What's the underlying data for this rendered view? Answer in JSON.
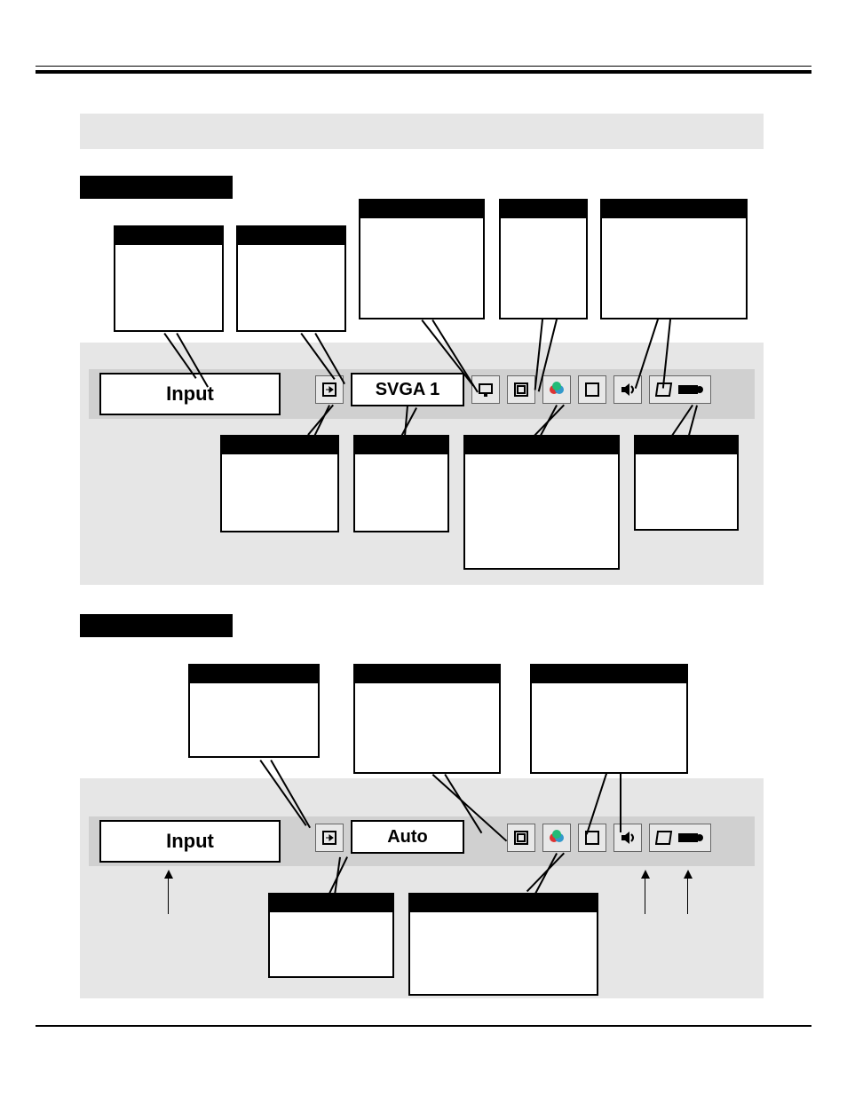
{
  "computer_mode": {
    "menubar": {
      "input_label": "Input",
      "system_label": "SVGA 1"
    }
  },
  "video_mode": {
    "menubar": {
      "input_label": "Input",
      "system_label": "Auto"
    }
  }
}
